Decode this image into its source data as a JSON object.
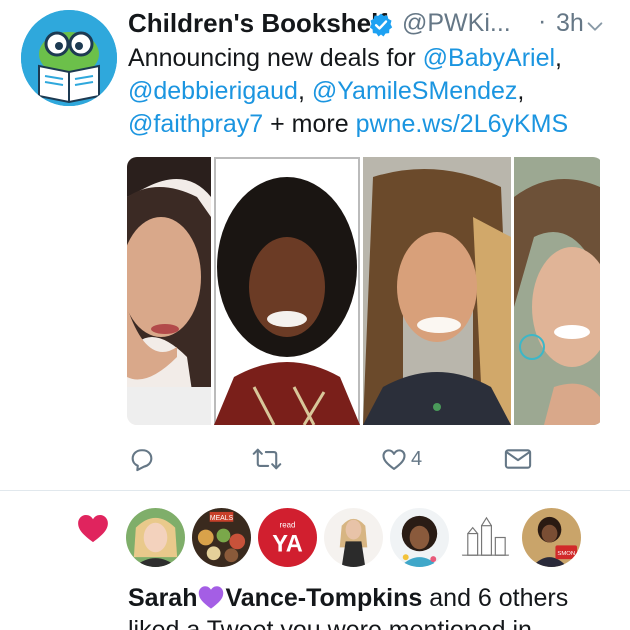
{
  "tweet": {
    "author_name": "Children's Bookshelf",
    "handle": "@PWKi...",
    "separator": "·",
    "time": "3h",
    "text": {
      "line1_prefix": "Announcing new deals for ",
      "mention1": "@BabyAriel",
      "line1_suffix": ",",
      "mention2": "@debbierigaud",
      "line2_sep": ", ",
      "mention3": "@YamileSMendez",
      "line2_suffix": ",",
      "mention4": "@faithpray7",
      "line3_mid": " + more ",
      "link": "pwne.ws/2L6yKMS"
    },
    "like_count": "4"
  },
  "notification": {
    "name_first": "Sarah",
    "name_last": "Vance-Tompkins",
    "suffix": " and 6 others",
    "line2": "liked a Tweet you were mentioned in",
    "avatar_texts": {
      "meals_label": "MEALS",
      "read_small": "read",
      "ya": "YA",
      "smon": "SMON"
    }
  },
  "colors": {
    "brand_blue": "#1b95e0",
    "muted": "#657786",
    "like_red": "#e0245e",
    "purple": "#a45ee5"
  },
  "icons": [
    "verified-badge-icon",
    "chevron-down-icon",
    "reply-icon",
    "retweet-icon",
    "like-icon",
    "direct-message-icon",
    "heart-icon",
    "purple-heart-icon"
  ]
}
